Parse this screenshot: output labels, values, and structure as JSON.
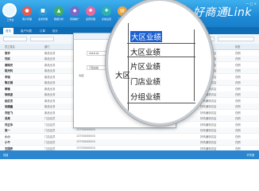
{
  "app": {
    "brand": "好商通Link",
    "logo_label": "工作台",
    "window_controls": "— □ ×"
  },
  "toolbar": {
    "buttons": [
      {
        "label": "客户管理",
        "color": "#e85a4f"
      },
      {
        "label": "业务管理",
        "color": "#2e9bd8"
      },
      {
        "label": "数据分析",
        "color": "#3cae6a"
      },
      {
        "label": "营销推广",
        "color": "#7c68c8"
      },
      {
        "label": "运营管理",
        "color": "#e46aa0"
      },
      {
        "label": "系统设置",
        "color": "#2bb3b0"
      },
      {
        "label": "工作报表",
        "color": "#f0a53a"
      },
      {
        "label": "更多",
        "color": "#4e84c4"
      }
    ]
  },
  "tabs": [
    "首页",
    "客户列表",
    "订单",
    "统计"
  ],
  "grid": {
    "headers": [
      "员工姓名",
      "部门",
      "手机号",
      "入职时间",
      "所属门店",
      "状态"
    ],
    "rows": [
      {
        "name": "张宇",
        "dept": "新品业务",
        "phone": "",
        "store": "好商通测试店",
        "status": "在职"
      },
      {
        "name": "刘欢",
        "dept": "新品业务",
        "phone": "",
        "store": "好商通测试店",
        "status": "在职"
      },
      {
        "name": "谢晓光",
        "dept": "新品业务",
        "phone": "",
        "store": "好商通测试店",
        "status": "在职"
      },
      {
        "name": "程光利",
        "dept": "新品业务",
        "phone": "",
        "store": "好商通测试店",
        "status": "在职"
      },
      {
        "name": "李强",
        "dept": "新品业务",
        "phone": "",
        "store": "好商通测试店",
        "status": "在职"
      },
      {
        "name": "陶丈娟",
        "dept": "新品业务",
        "phone": "",
        "store": "好商通测试店",
        "status": "在职"
      },
      {
        "name": "黎雅",
        "dept": "新品业务",
        "phone": "",
        "store": "好商通测试店",
        "status": "在职"
      },
      {
        "name": "徐晓波",
        "dept": "新品业务",
        "phone": "",
        "store": "好商通测试店",
        "status": "在职"
      },
      {
        "name": "赵红杰",
        "dept": "新品业务",
        "phone": "",
        "store": "好商通测试店",
        "status": "在职"
      },
      {
        "name": "胡建鑫",
        "dept": "新品业务",
        "phone": "",
        "store": "好商通测试店",
        "status": "在职"
      },
      {
        "name": "刘宏飞",
        "dept": "新品业务",
        "phone": "",
        "store": "好商通测试店",
        "status": "在职"
      },
      {
        "name": "吴亮",
        "dept": "门店店员",
        "phone": "13700000000",
        "store": "好商通测试店",
        "status": "在职"
      },
      {
        "name": "刘立华",
        "dept": "门店店员",
        "phone": "13700000000",
        "store": "好商通测试店",
        "status": "在职"
      },
      {
        "name": "张一",
        "dept": "门店店员",
        "phone": "13700000000",
        "store": "好商通测试店",
        "status": "在职"
      },
      {
        "name": "小小",
        "dept": "门店店员",
        "phone": "13700000000",
        "store": "好商通测试店",
        "status": "在职"
      },
      {
        "name": "小千",
        "dept": "门店店员",
        "phone": "13700000000",
        "store": "好商通测试店",
        "status": "在职"
      },
      {
        "name": "王国庆",
        "dept": "门店店员",
        "phone": "13700000000",
        "store": "好商通测试店",
        "status": "在职"
      }
    ]
  },
  "dialog": {
    "date_value": "2018-01",
    "type_value": "门店业绩",
    "side_label": "大区",
    "ok_label": "确定"
  },
  "lens": {
    "options": [
      "大区业绩",
      "大区业绩",
      "片区业绩",
      "门店业绩",
      "分组业绩"
    ]
  },
  "statusbar": {
    "left": "就绪",
    "right": "好商通"
  }
}
